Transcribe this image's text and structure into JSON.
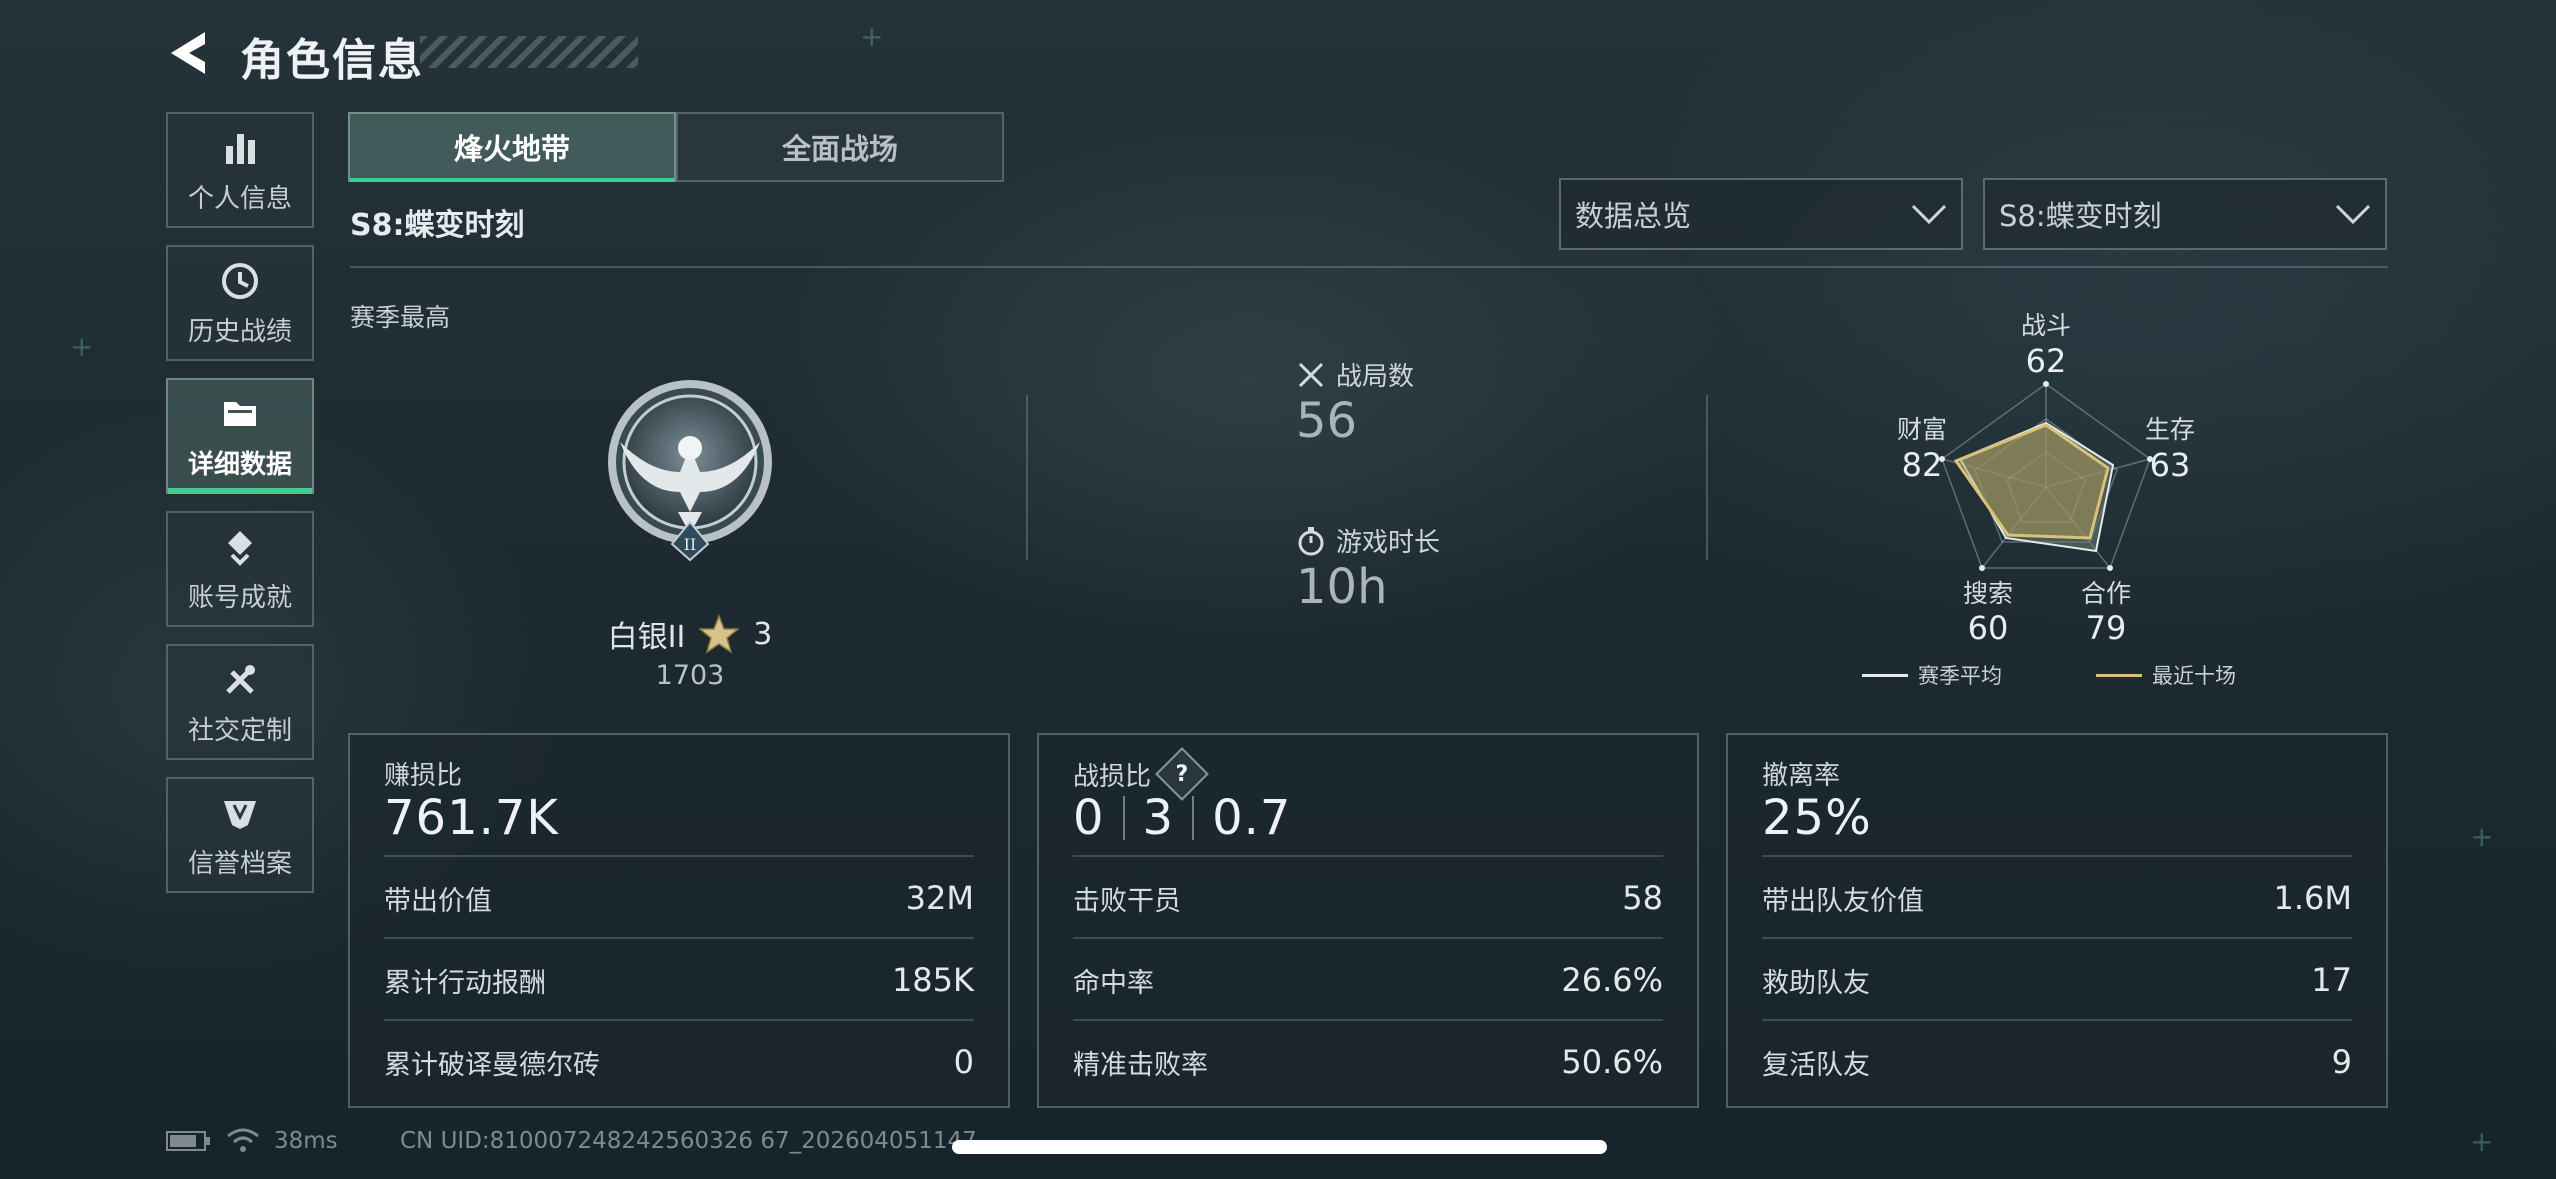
{
  "header": {
    "title": "角色信息"
  },
  "sidebar": {
    "items": [
      {
        "label": "个人信息"
      },
      {
        "label": "历史战绩"
      },
      {
        "label": "详细数据"
      },
      {
        "label": "账号成就"
      },
      {
        "label": "社交定制"
      },
      {
        "label": "信誉档案"
      }
    ]
  },
  "tabs": [
    {
      "label": "烽火地带"
    },
    {
      "label": "全面战场"
    }
  ],
  "season": {
    "title": "S8:蝶变时刻"
  },
  "dropdowns": {
    "view": "数据总览",
    "season": "S8:蝶变时刻"
  },
  "section": {
    "label": "赛季最高"
  },
  "rank": {
    "name": "白银II",
    "stars": "3",
    "score": "1703",
    "badge_numeral": "II"
  },
  "matches": {
    "label": "战局数",
    "value": "56"
  },
  "playtime": {
    "label": "游戏时长",
    "value": "10h"
  },
  "radar": {
    "axes": [
      {
        "label": "战斗",
        "value": "62"
      },
      {
        "label": "生存",
        "value": "63"
      },
      {
        "label": "合作",
        "value": "79"
      },
      {
        "label": "搜索",
        "value": "60"
      },
      {
        "label": "财富",
        "value": "82"
      }
    ],
    "legend": [
      {
        "label": "赛季平均",
        "color": "#e6eaec"
      },
      {
        "label": "最近十场",
        "color": "#d8c27a"
      }
    ]
  },
  "cards": [
    {
      "label": "赚损比",
      "value": "761.7K",
      "rows": [
        {
          "label": "带出价值",
          "value": "32M"
        },
        {
          "label": "累计行动报酬",
          "value": "185K"
        },
        {
          "label": "累计破译曼德尔砖",
          "value": "0"
        }
      ]
    },
    {
      "label": "战损比",
      "help": "?",
      "kd": [
        "0",
        "3",
        "0.7"
      ],
      "rows": [
        {
          "label": "击败干员",
          "value": "58"
        },
        {
          "label": "命中率",
          "value": "26.6%"
        },
        {
          "label": "精准击败率",
          "value": "50.6%"
        }
      ]
    },
    {
      "label": "撤离率",
      "value": "25%",
      "rows": [
        {
          "label": "带出队友价值",
          "value": "1.6M"
        },
        {
          "label": "救助队友",
          "value": "17"
        },
        {
          "label": "复活队友",
          "value": "9"
        }
      ]
    }
  ],
  "status": {
    "ping": "38ms",
    "uid": "CN UID:810007248242560326 67_202604051147"
  },
  "colors": {
    "accent": "#3fd08f",
    "radar_recent": "#d8c27a",
    "radar_avg": "#e6eaec"
  }
}
